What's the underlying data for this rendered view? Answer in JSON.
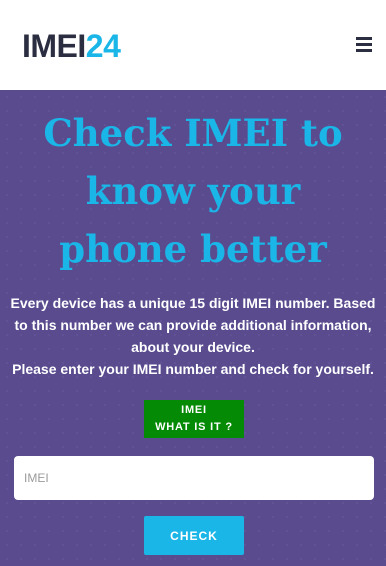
{
  "header": {
    "logo_part1": "IMEI",
    "logo_part2": "24",
    "menu_icon": "hamburger-menu-icon"
  },
  "hero": {
    "title_line1": "Check IMEI to",
    "title_line2": "know your",
    "title_line3": "phone better",
    "description": "Every device has a unique 15 digit IMEI number. Based to this number we can provide additional information, about your device.",
    "instruction": "Please enter your IMEI number and check for yourself.",
    "info_button_line1": "IMEI",
    "info_button_line2": "WHAT IS IT ?",
    "input_placeholder": "IMEI",
    "check_label": "CHECK"
  },
  "colors": {
    "accent": "#1ab6e8",
    "background": "#5a4b8f",
    "info_green": "#058a05",
    "logo_dark": "#2b2e40"
  }
}
